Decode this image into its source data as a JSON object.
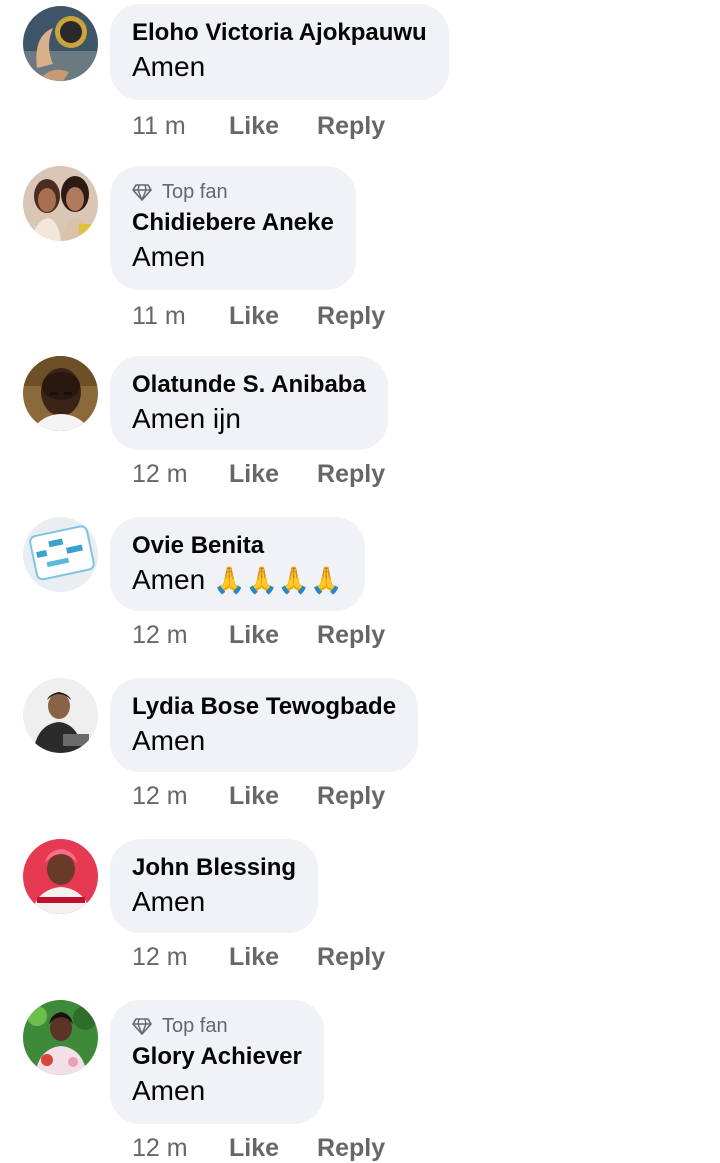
{
  "comments": [
    {
      "name": "Eloho Victoria Ajokpauwu",
      "text": "Amen",
      "time": "11 m",
      "like": "Like",
      "reply": "Reply",
      "top_fan": false,
      "avatar_icon": "profile-photo"
    },
    {
      "name": "Chidiebere Aneke",
      "text": "Amen",
      "time": "11 m",
      "like": "Like",
      "reply": "Reply",
      "top_fan": true,
      "badge": "Top fan",
      "avatar_icon": "profile-photo"
    },
    {
      "name": "Olatunde S. Anibaba",
      "text": "Amen ijn",
      "time": "12 m",
      "like": "Like",
      "reply": "Reply",
      "top_fan": false,
      "avatar_icon": "profile-photo"
    },
    {
      "name": "Ovie Benita",
      "text": "Amen",
      "emoji": "🙏🙏🙏🙏",
      "time": "12 m",
      "like": "Like",
      "reply": "Reply",
      "top_fan": false,
      "avatar_icon": "profile-photo"
    },
    {
      "name": "Lydia Bose Tewogbade",
      "text": "Amen",
      "time": "12 m",
      "like": "Like",
      "reply": "Reply",
      "top_fan": false,
      "avatar_icon": "profile-photo"
    },
    {
      "name": "John Blessing",
      "text": "Amen",
      "time": "12 m",
      "like": "Like",
      "reply": "Reply",
      "top_fan": false,
      "avatar_icon": "profile-photo"
    },
    {
      "name": "Glory Achiever",
      "text": "Amen",
      "time": "12 m",
      "like": "Like",
      "reply": "Reply",
      "top_fan": true,
      "badge": "Top fan",
      "avatar_icon": "profile-photo"
    }
  ],
  "colors": {
    "bubble": "#f0f2f5",
    "secondary_text": "#65676b",
    "primary_text": "#050505"
  }
}
